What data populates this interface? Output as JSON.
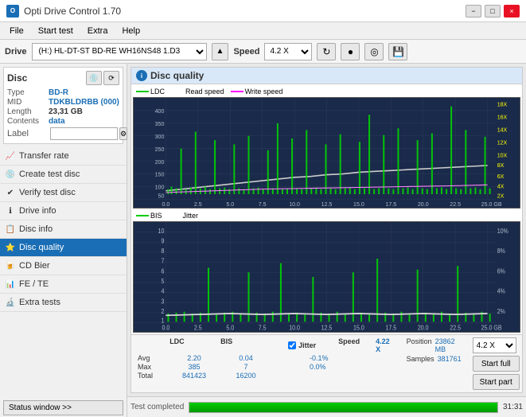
{
  "titleBar": {
    "title": "Opti Drive Control 1.70",
    "minLabel": "−",
    "maxLabel": "□",
    "closeLabel": "×"
  },
  "menuBar": {
    "items": [
      "File",
      "Start test",
      "Extra",
      "Help"
    ]
  },
  "toolbar": {
    "driveLabel": "Drive",
    "driveValue": "(H:)  HL-DT-ST BD-RE  WH16NS48 1.D3",
    "ejectLabel": "▲",
    "speedLabel": "Speed",
    "speedValue": "4.2 X",
    "icons": [
      "↻",
      "●",
      "◎",
      "💾"
    ]
  },
  "disc": {
    "sectionLabel": "Disc",
    "type": {
      "key": "Type",
      "val": "BD-R"
    },
    "mid": {
      "key": "MID",
      "val": "TDKBLDRBB (000)"
    },
    "length": {
      "key": "Length",
      "val": "23,31 GB"
    },
    "contents": {
      "key": "Contents",
      "val": "data"
    },
    "label": {
      "key": "Label",
      "val": ""
    },
    "labelPlaceholder": ""
  },
  "navItems": [
    {
      "id": "transfer-rate",
      "label": "Transfer rate",
      "icon": "📈"
    },
    {
      "id": "create-test-disc",
      "label": "Create test disc",
      "icon": "💿"
    },
    {
      "id": "verify-test-disc",
      "label": "Verify test disc",
      "icon": "✔"
    },
    {
      "id": "drive-info",
      "label": "Drive info",
      "icon": "ℹ"
    },
    {
      "id": "disc-info",
      "label": "Disc info",
      "icon": "📋"
    },
    {
      "id": "disc-quality",
      "label": "Disc quality",
      "icon": "⭐",
      "active": true
    },
    {
      "id": "cd-bier",
      "label": "CD Bier",
      "icon": "🍺"
    },
    {
      "id": "fe-te",
      "label": "FE / TE",
      "icon": "📊"
    },
    {
      "id": "extra-tests",
      "label": "Extra tests",
      "icon": "🔬"
    }
  ],
  "statusWindow": {
    "label": "Status window >>",
    "statusText": "Test completed"
  },
  "discQuality": {
    "title": "Disc quality",
    "icon": "i",
    "legend1": {
      "ldc": "LDC",
      "readSpeed": "Read speed",
      "writeSpeed": "Write speed"
    },
    "legend2": {
      "bis": "BIS",
      "jitter": "Jitter"
    },
    "yAxisTop": [
      "400",
      "350",
      "300",
      "250",
      "200",
      "150",
      "100",
      "50"
    ],
    "yAxisTopRight": [
      "18X",
      "16X",
      "14X",
      "12X",
      "10X",
      "8X",
      "6X",
      "4X",
      "2X"
    ],
    "xAxis": [
      "0.0",
      "2.5",
      "5.0",
      "7.5",
      "10.0",
      "12.5",
      "15.0",
      "17.5",
      "20.0",
      "22.5",
      "25.0 GB"
    ],
    "yAxisBot": [
      "10",
      "9",
      "8",
      "7",
      "6",
      "5",
      "4",
      "3",
      "2",
      "1"
    ],
    "yAxisBotRight": [
      "10%",
      "8%",
      "6%",
      "4%",
      "2%"
    ],
    "stats": {
      "headers": [
        "LDC",
        "BIS",
        "",
        "Jitter",
        "Speed"
      ],
      "avg": {
        "label": "Avg",
        "ldc": "2.20",
        "bis": "0.04",
        "jitter": "-0.1%",
        "speed": "4.22 X"
      },
      "max": {
        "label": "Max",
        "ldc": "385",
        "bis": "7",
        "jitter": "0.0%"
      },
      "total": {
        "label": "Total",
        "ldc": "841423",
        "bis": "16200"
      },
      "position": {
        "label": "Position",
        "val": "23862 MB"
      },
      "samples": {
        "label": "Samples",
        "val": "381761"
      }
    },
    "speedSelect": "4.2 X",
    "startFull": "Start full",
    "startPart": "Start part"
  },
  "bottomBar": {
    "statusText": "Test completed",
    "progress": "100.0%",
    "progressVal": 100,
    "time": "31:31"
  }
}
